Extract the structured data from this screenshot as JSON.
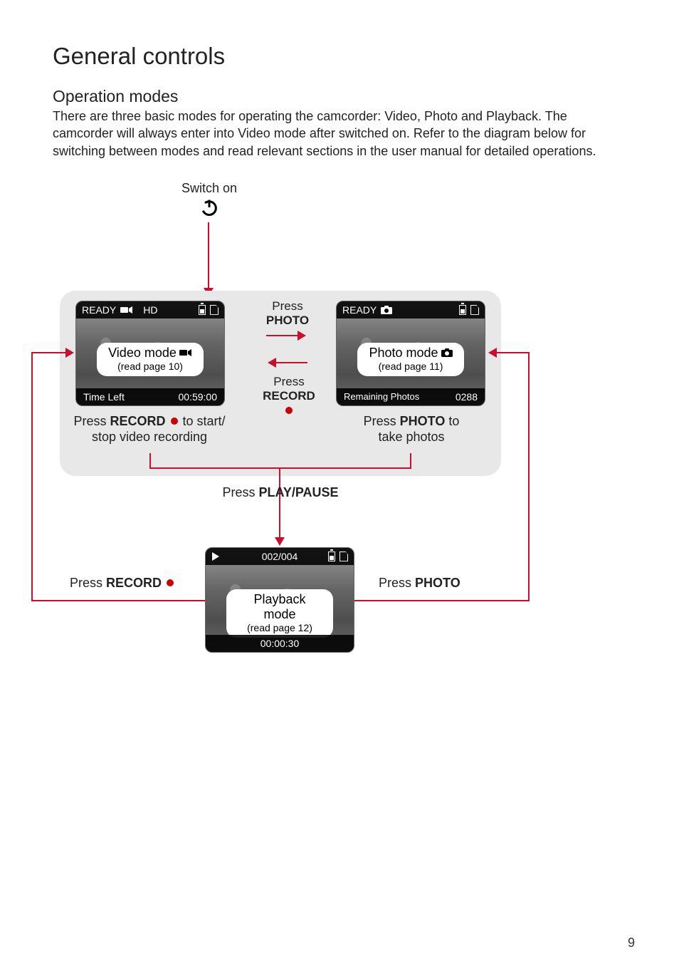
{
  "page": {
    "title": "General controls",
    "section": "Operation modes",
    "intro": "There are three basic modes for operating the camcorder: Video, Photo and Playback. The camcorder will always enter into Video mode after switched on. Refer to the diagram below for switching between modes and read relevant sections in the user manual for detailed operations.",
    "number": "9"
  },
  "diagram": {
    "switch_on": "Switch on",
    "press_word": "Press",
    "photo_word": "PHOTO",
    "record_word": "RECORD",
    "play_pause": "PLAY/PAUSE",
    "press_play_pause_prefix": "Press ",
    "press_record_prefix": "Press ",
    "press_photo_prefix": "Press ",
    "left_return": "Press RECORD",
    "right_return": "Press PHOTO"
  },
  "video": {
    "ready": "READY",
    "hd": "HD",
    "mode_title": "Video mode",
    "mode_sub": "(read page 10)",
    "time_left_label": "Time Left",
    "time_left_value": "00:59:00",
    "caption_prefix": "Press ",
    "caption_bold": "RECORD",
    "caption_suffix1": " to start/",
    "caption_line2": "stop video recording"
  },
  "photo": {
    "ready": "READY",
    "mode_title": "Photo mode",
    "mode_sub": "(read page 11)",
    "remaining_label": "Remaining Photos",
    "remaining_value": "0288",
    "caption_prefix": "Press ",
    "caption_bold": "PHOTO",
    "caption_suffix": " to",
    "caption_line2": "take photos"
  },
  "playback": {
    "counter": "002/004",
    "mode_title": "Playback mode",
    "mode_sub": "(read page 12)",
    "time": "00:00:30"
  }
}
